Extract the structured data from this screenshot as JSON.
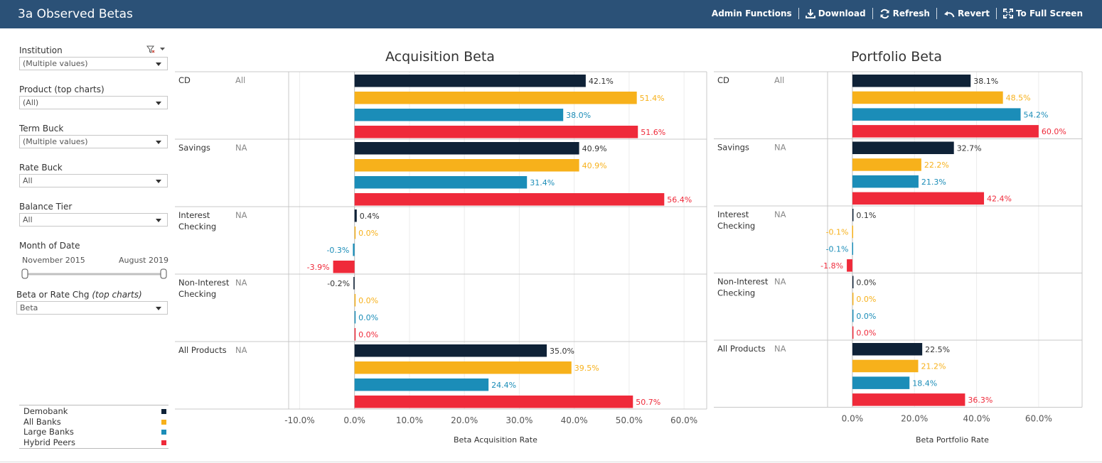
{
  "header": {
    "title": "3a Observed Betas",
    "actions": [
      {
        "label": "Admin Functions",
        "icon": "none"
      },
      {
        "label": "Download",
        "icon": "download-icon"
      },
      {
        "label": "Refresh",
        "icon": "refresh-icon"
      },
      {
        "label": "Revert",
        "icon": "revert-icon"
      },
      {
        "label": "To Full Screen",
        "icon": "fullscreen-icon"
      }
    ]
  },
  "filters": {
    "institution": {
      "label": "Institution",
      "value": "(Multiple values)"
    },
    "product": {
      "label": "Product (top charts)",
      "value": "(All)"
    },
    "term_buck": {
      "label": "Term Buck",
      "value": "(Multiple values)"
    },
    "rate_buck": {
      "label": "Rate Buck",
      "value": "All"
    },
    "balance_tier": {
      "label": "Balance Tier",
      "value": "All"
    },
    "month": {
      "label": "Month of Date",
      "start": "November 2015",
      "end": "August 2019"
    },
    "beta_or_rate": {
      "label": "Beta or Rate Chg",
      "label_italic": "(top charts)",
      "value": "Beta"
    }
  },
  "legend": [
    {
      "name": "Demobank",
      "color": "#0f2237"
    },
    {
      "name": "All Banks",
      "color": "#f7b11b"
    },
    {
      "name": "Large Banks",
      "color": "#1b8db8"
    },
    {
      "name": "Hybrid Peers",
      "color": "#ef2a3a"
    }
  ],
  "chart_data": [
    {
      "type": "bar",
      "orientation": "horizontal",
      "title": "Acquisition Beta",
      "xlabel": "Beta Acquisition Rate",
      "xlim": [
        -0.12,
        0.64
      ],
      "ticks": [
        -0.1,
        0,
        0.1,
        0.2,
        0.3,
        0.4,
        0.5,
        0.6
      ],
      "tick_labels": [
        "-10.0%",
        "0.0%",
        "10.0%",
        "20.0%",
        "30.0%",
        "40.0%",
        "50.0%",
        "60.0%"
      ],
      "grid": true,
      "groups": [
        {
          "label": "CD",
          "sub": "All",
          "values": [
            0.421,
            0.514,
            0.38,
            0.516
          ],
          "labels": [
            "42.1%",
            "51.4%",
            "38.0%",
            "51.6%"
          ]
        },
        {
          "label": "Savings",
          "sub": "NA",
          "values": [
            0.409,
            0.409,
            0.314,
            0.564
          ],
          "labels": [
            "40.9%",
            "40.9%",
            "31.4%",
            "56.4%"
          ]
        },
        {
          "label": "Interest Checking",
          "sub": "NA",
          "values": [
            0.004,
            0.0,
            -0.003,
            -0.039
          ],
          "labels": [
            "0.4%",
            "0.0%",
            "-0.3%",
            "-3.9%"
          ]
        },
        {
          "label": "Non-Interest Checking",
          "sub": "NA",
          "values": [
            -0.002,
            0.0,
            0.0,
            0.0
          ],
          "labels": [
            "-0.2%",
            "0.0%",
            "0.0%",
            "0.0%"
          ]
        },
        {
          "label": "All Products",
          "sub": "NA",
          "values": [
            0.35,
            0.395,
            0.244,
            0.507
          ],
          "labels": [
            "35.0%",
            "39.5%",
            "24.4%",
            "50.7%"
          ]
        }
      ]
    },
    {
      "type": "bar",
      "orientation": "horizontal",
      "title": "Portfolio Beta",
      "xlabel": "Beta Portfolio Rate",
      "xlim": [
        -0.08,
        0.74
      ],
      "ticks": [
        0,
        0.2,
        0.4,
        0.6
      ],
      "tick_labels": [
        "0.0%",
        "20.0%",
        "40.0%",
        "60.0%"
      ],
      "grid": true,
      "groups": [
        {
          "label": "CD",
          "sub": "All",
          "values": [
            0.381,
            0.485,
            0.542,
            0.6
          ],
          "labels": [
            "38.1%",
            "48.5%",
            "54.2%",
            "60.0%"
          ]
        },
        {
          "label": "Savings",
          "sub": "NA",
          "values": [
            0.327,
            0.222,
            0.213,
            0.424
          ],
          "labels": [
            "32.7%",
            "22.2%",
            "21.3%",
            "42.4%"
          ]
        },
        {
          "label": "Interest Checking",
          "sub": "NA",
          "values": [
            0.001,
            -0.001,
            -0.001,
            -0.018
          ],
          "labels": [
            "0.1%",
            "-0.1%",
            "-0.1%",
            "-1.8%"
          ]
        },
        {
          "label": "Non-Interest Checking",
          "sub": "NA",
          "values": [
            0.0,
            0.0,
            0.0,
            0.0
          ],
          "labels": [
            "0.0%",
            "0.0%",
            "0.0%",
            "0.0%"
          ]
        },
        {
          "label": "All Products",
          "sub": "NA",
          "values": [
            0.225,
            0.212,
            0.184,
            0.363
          ],
          "labels": [
            "22.5%",
            "21.2%",
            "18.4%",
            "36.3%"
          ]
        }
      ]
    }
  ]
}
